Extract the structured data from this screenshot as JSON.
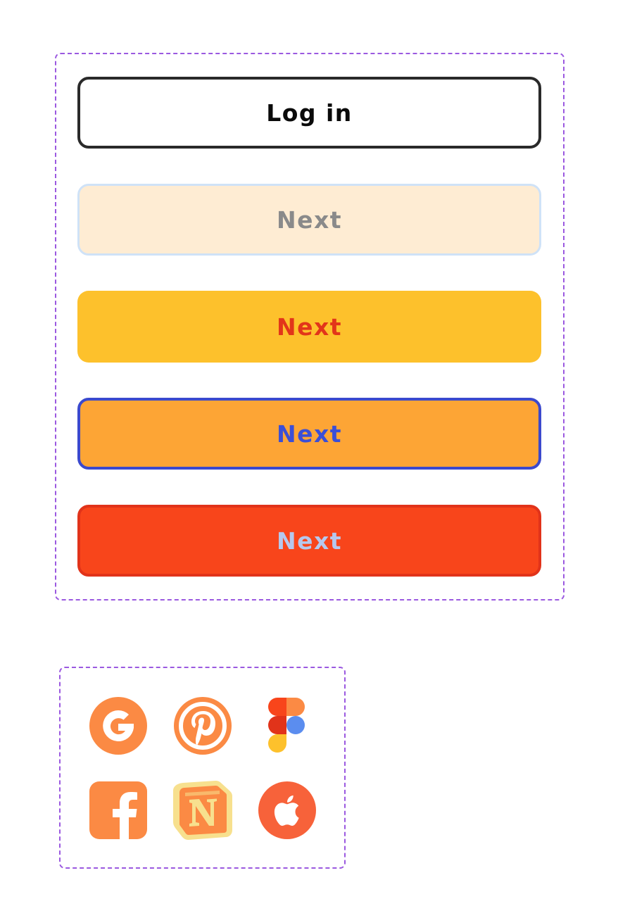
{
  "buttons": {
    "login_label": "Log in",
    "next_1_label": "Next",
    "next_2_label": "Next",
    "next_3_label": "Next",
    "next_4_label": "Next"
  },
  "icons": [
    {
      "name": "google-icon",
      "color": "#fb8a44"
    },
    {
      "name": "pinterest-icon",
      "color": "#fb8a44"
    },
    {
      "name": "figma-icon",
      "colors": [
        "#f8451b",
        "#fb8a44",
        "#e1331a",
        "#5b8def",
        "#fdc12c"
      ]
    },
    {
      "name": "facebook-icon",
      "color": "#fb8a44"
    },
    {
      "name": "notion-icon",
      "color": "#fb8a44"
    },
    {
      "name": "apple-icon",
      "color": "#f7623a"
    }
  ],
  "colors": {
    "frame_dash": "#9b59e0",
    "accent_orange": "#fb8a44"
  }
}
